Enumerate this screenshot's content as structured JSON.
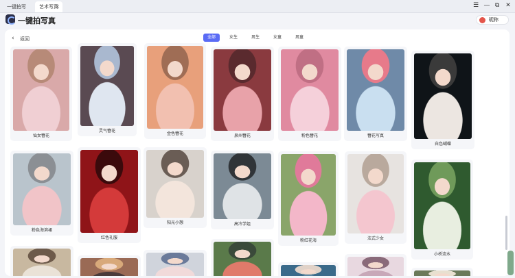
{
  "window": {
    "tabs": [
      {
        "label": "一键拍写真"
      },
      {
        "label": "艺术写真"
      }
    ],
    "controls": [
      "☰",
      "—",
      "⧉",
      "✕"
    ]
  },
  "app": {
    "title": "一键拍写真",
    "user_label": "昵称"
  },
  "nav": {
    "back_label": "返回"
  },
  "filters": [
    {
      "label": "全部",
      "active": true
    },
    {
      "label": "女生",
      "active": false
    },
    {
      "label": "男生",
      "active": false
    },
    {
      "label": "女童",
      "active": false
    },
    {
      "label": "男童",
      "active": false
    }
  ],
  "cards": [
    {
      "label": "仙女簪花",
      "colors": [
        "#d9a9a9",
        "#f0cfd3",
        "#b78a78"
      ]
    },
    {
      "label": "灵气簪花",
      "colors": [
        "#5a4a52",
        "#dfe6f0",
        "#a9b8cf"
      ]
    },
    {
      "label": "金色簪花",
      "colors": [
        "#e8a07b",
        "#f2c0b0",
        "#9f6d55"
      ]
    },
    {
      "label": "泉州簪花",
      "colors": [
        "#8a3a3f",
        "#e8a2a9",
        "#5a2a2e"
      ]
    },
    {
      "label": "粉色簪花",
      "colors": [
        "#e08aa0",
        "#f5d0da",
        "#c06f84"
      ]
    },
    {
      "label": "簪花写真",
      "colors": [
        "#6f8aa8",
        "#c9dff0",
        "#e77a8a"
      ]
    },
    {
      "label": "白色蝴蝶",
      "colors": [
        "#0f1418",
        "#ece6e1",
        "#3a3a3a"
      ]
    },
    {
      "label": "粉色海滨裙",
      "colors": [
        "#b9c4cc",
        "#f1c4c8",
        "#8b8f94"
      ]
    },
    {
      "label": "红色礼服",
      "colors": [
        "#8f1418",
        "#d43a3a",
        "#3b0a0c"
      ]
    },
    {
      "label": "阳光小憩",
      "colors": [
        "#d8d2cc",
        "#f3e5dc",
        "#6a5d55"
      ]
    },
    {
      "label": "高冷学姐",
      "colors": [
        "#7c8a95",
        "#dfe3e6",
        "#303438"
      ]
    },
    {
      "label": "粉红花海",
      "colors": [
        "#8aa56a",
        "#f3b7c9",
        "#e07a9a"
      ]
    },
    {
      "label": "法式少女",
      "colors": [
        "#e7e3e0",
        "#f4c6cf",
        "#b9a99d"
      ]
    },
    {
      "label": "小桥流水",
      "colors": [
        "#2f5a2f",
        "#e8eee0",
        "#6f9a5a"
      ]
    },
    {
      "label": "",
      "colors": [
        "#c8b8a0",
        "#eae2d7",
        "#6d5a4a"
      ]
    },
    {
      "label": "",
      "colors": [
        "#9a6a55",
        "#4a3a3a",
        "#d8a97a"
      ]
    },
    {
      "label": "",
      "colors": [
        "#d0d4dc",
        "#f1dada",
        "#6a7a9a"
      ]
    },
    {
      "label": "",
      "colors": [
        "#5a7a4a",
        "#e07a6a",
        "#3a4a3a"
      ]
    },
    {
      "label": "",
      "colors": [
        "#3a6a8a",
        "#8ab0c8",
        "#e0d2c8"
      ]
    },
    {
      "label": "",
      "colors": [
        "#e8d8e0",
        "#c8a8b8",
        "#8a6a7a"
      ]
    },
    {
      "label": "",
      "colors": [
        "#6a7a5a",
        "#b8c8a8",
        "#e8e0d0"
      ]
    }
  ]
}
